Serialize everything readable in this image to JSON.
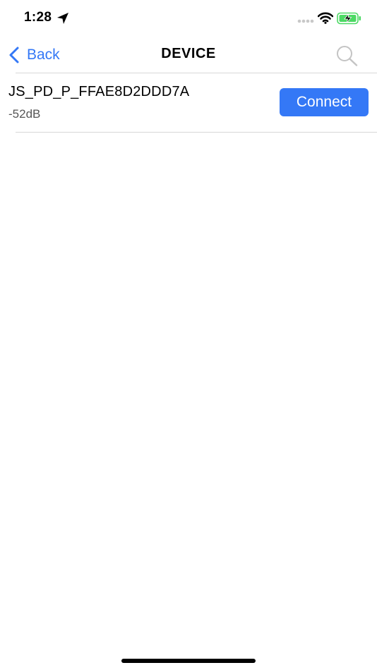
{
  "status_bar": {
    "time": "1:28",
    "icons": [
      "location-arrow-icon",
      "cellular-signal-icon",
      "wifi-icon",
      "battery-charging-icon"
    ]
  },
  "nav": {
    "back_label": "Back",
    "title": "DEVICE",
    "back_icon": "chevron-left-icon",
    "search_icon": "search-icon"
  },
  "devices": [
    {
      "name": "JS_PD_P_FFAE8D2DDD7A",
      "rssi": "-52dB",
      "action_label": "Connect"
    }
  ],
  "colors": {
    "accent": "#3478f6",
    "battery": "#4cd964",
    "separator": "#d8d8d8",
    "secondary_text": "#555555"
  }
}
